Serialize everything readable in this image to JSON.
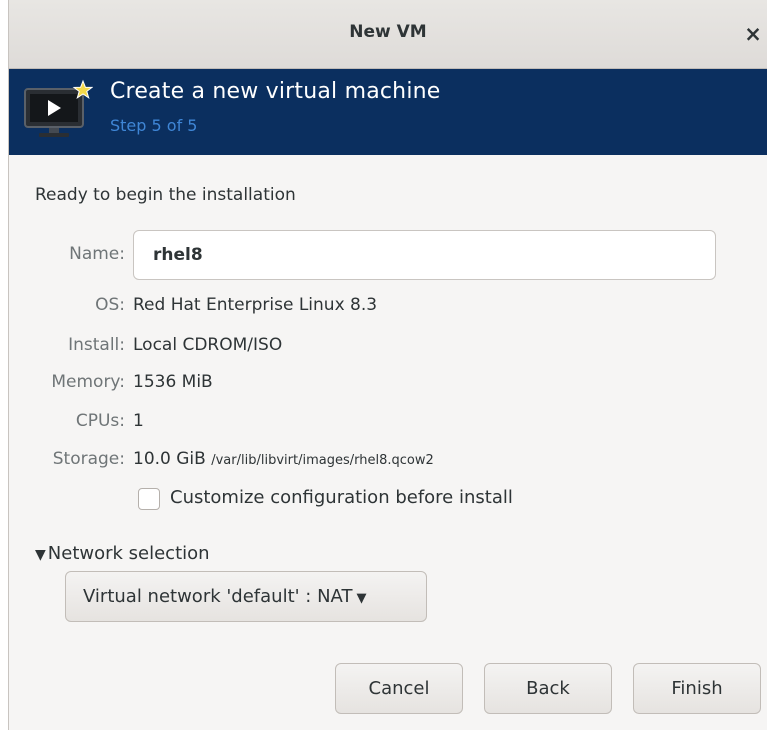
{
  "window": {
    "title": "New VM",
    "close_glyph": "×"
  },
  "banner": {
    "icon": "monitor-play-icon",
    "title": "Create a new virtual machine",
    "step": "Step 5 of 5"
  },
  "summary": {
    "heading": "Ready to begin the installation",
    "name_label": "Name:",
    "name_value": "rhel8",
    "os_label": "OS:",
    "os_value": "Red Hat Enterprise Linux 8.3",
    "install_label": "Install:",
    "install_value": "Local CDROM/ISO",
    "memory_label": "Memory:",
    "memory_value": "1536 MiB",
    "cpus_label": "CPUs:",
    "cpus_value": "1",
    "storage_label": "Storage:",
    "storage_size": "10.0 GiB",
    "storage_path": "/var/lib/libvirt/images/rhel8.qcow2"
  },
  "customize": {
    "label": "Customize configuration before install",
    "checked": false
  },
  "network": {
    "expander_label": "Network selection",
    "expanded": true,
    "selected": "Virtual network 'default' : NAT"
  },
  "buttons": {
    "cancel": "Cancel",
    "back": "Back",
    "finish": "Finish"
  },
  "colors": {
    "banner_bg": "#0b2f5f",
    "step_text": "#3f86d6"
  }
}
